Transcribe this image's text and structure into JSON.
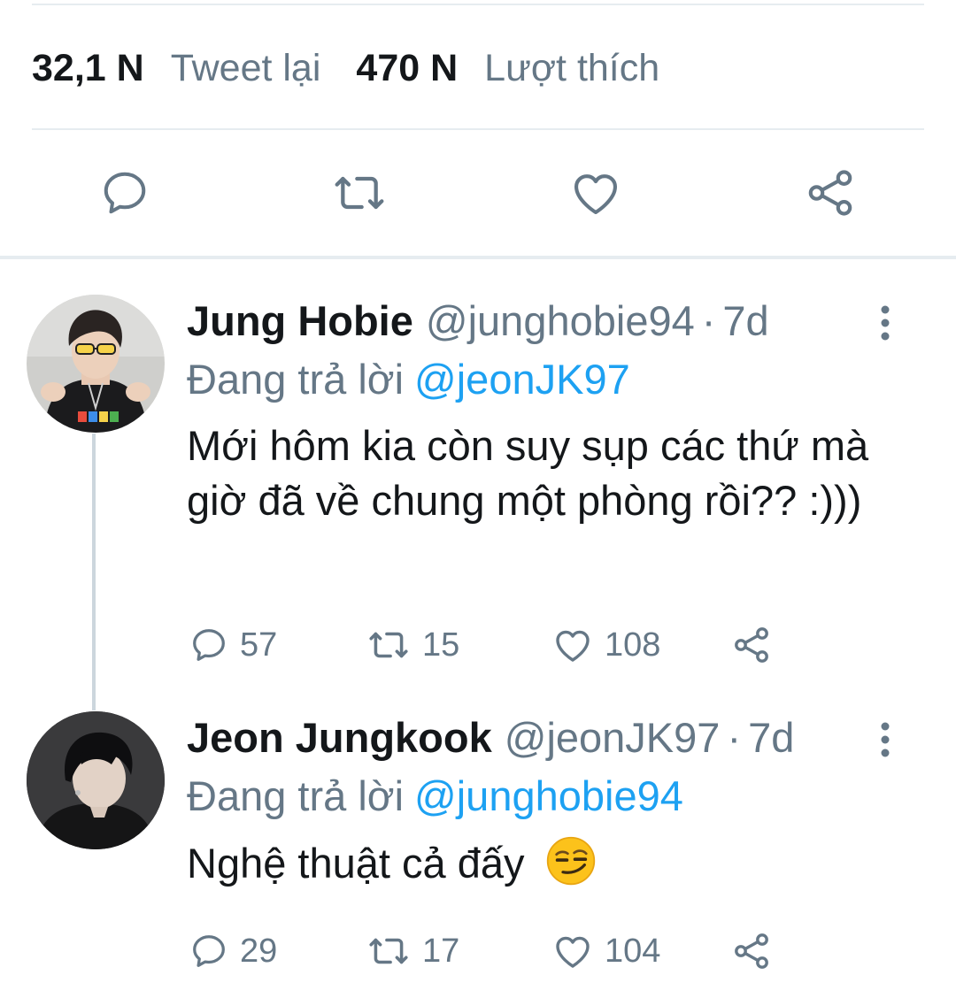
{
  "stats": {
    "retweets_count": "32,1 N",
    "retweets_label": "Tweet lại",
    "likes_count": "470 N",
    "likes_label": "Lượt thích"
  },
  "main_actions": {
    "icons": [
      "reply-icon",
      "retweet-icon",
      "like-icon",
      "share-icon"
    ]
  },
  "tweets": [
    {
      "name": "Jung Hobie",
      "handle": "@junghobie94",
      "separator": "·",
      "time": "7d",
      "reply_prefix": "Đang trả lời",
      "reply_to": "@jeonJK97",
      "text": "Mới hôm kia còn suy sụp các thứ mà giờ đã về chung một phòng rồi?? :)))",
      "replies": "57",
      "retweets": "15",
      "likes": "108"
    },
    {
      "name": "Jeon Jungkook",
      "handle": "@jeonJK97",
      "separator": "·",
      "time": "7d",
      "reply_prefix": "Đang trả lời",
      "reply_to": "@junghobie94",
      "text": "Nghệ thuật cả đấy",
      "emoji": "smirking-face-emoji",
      "replies": "29",
      "retweets": "17",
      "likes": "104"
    }
  ],
  "colors": {
    "link": "#1da1f2",
    "muted": "#657786",
    "text": "#14171a",
    "divider": "#e6ecf0"
  }
}
